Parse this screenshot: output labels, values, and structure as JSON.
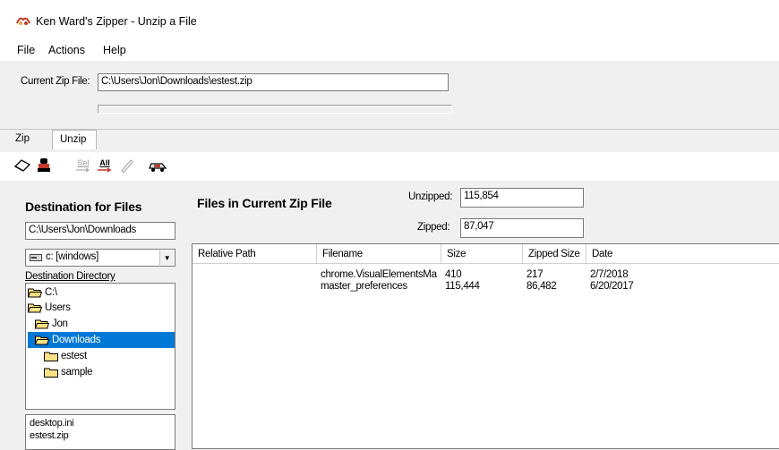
{
  "window": {
    "title": "Ken Ward's Zipper - Unzip a File"
  },
  "menu": [
    "File",
    "Actions",
    "Help"
  ],
  "zip": {
    "label": "Current Zip File:",
    "value": "C:\\Users\\Jon\\Downloads\\estest.zip"
  },
  "tabs": [
    {
      "label": "Zip",
      "active": false
    },
    {
      "label": "Unzip",
      "active": true
    }
  ],
  "toolbar": {
    "buttons": [
      {
        "name": "eraser-icon"
      },
      {
        "name": "stamp-icon"
      },
      {
        "name": "select-some",
        "label": "Sel"
      },
      {
        "name": "select-all",
        "label": "All"
      },
      {
        "name": "edit-icon"
      },
      {
        "name": "car-icon"
      }
    ]
  },
  "destination": {
    "title": "Destination for Files",
    "path": "C:\\Users\\Jon\\Downloads",
    "drive": "c: [windows]",
    "dir_label": "Destination Directory",
    "tree": [
      {
        "label": "C:\\",
        "level": 0,
        "open": true,
        "selected": false
      },
      {
        "label": "Users",
        "level": 0,
        "open": true,
        "selected": false
      },
      {
        "label": "Jon",
        "level": 1,
        "open": true,
        "selected": false
      },
      {
        "label": "Downloads",
        "level": 1,
        "open": true,
        "selected": true
      },
      {
        "label": "estest",
        "level": 2,
        "open": false,
        "selected": false
      },
      {
        "label": "sample",
        "level": 2,
        "open": false,
        "selected": false
      }
    ],
    "files": [
      "desktop.ini",
      "estest.zip"
    ]
  },
  "zipfiles": {
    "title": "Files in Current Zip File",
    "unzipped_label": "Unzipped:",
    "unzipped": "115,854",
    "zipped_label": "Zipped:",
    "zipped": "87,047",
    "columns": [
      "Relative Path",
      "Filename",
      "Size",
      "Zipped Size",
      "Date"
    ],
    "rows": [
      {
        "path": "",
        "filename": "chrome.VisualElementsMa",
        "size": "410",
        "zipped": "217",
        "date": "2/7/2018"
      },
      {
        "path": "",
        "filename": "master_preferences",
        "size": "115,444",
        "zipped": "86,482",
        "date": "6/20/2017"
      }
    ]
  },
  "colors": {
    "selection": "#0078d7",
    "folder": "#ffe082"
  }
}
